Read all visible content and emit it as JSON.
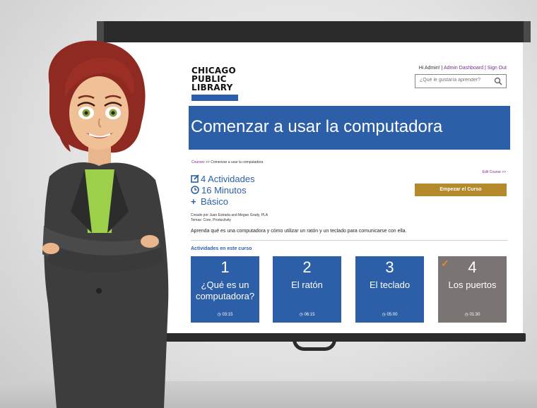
{
  "site": {
    "logo_lines": [
      "CHICAGO",
      "PUBLIC",
      "LIBRARY"
    ],
    "greeting": "Hi Admin! |",
    "nav_admin": "Admin Dashboard",
    "nav_sep": "|",
    "nav_signout": "Sign Out",
    "search_placeholder": "¿Qué le gustaría aprender?",
    "search_icon": "search-icon"
  },
  "course": {
    "title": "Comenzar a usar la computadora",
    "breadcrumb_link": "Courses",
    "breadcrumb_rest": " >> Comenzar a usar la computadora",
    "edit_label": "Edit Course >>",
    "activities": "4 Actividades",
    "minutes": "16 Minutos",
    "level": "Básico",
    "creator": "Creado por Juan Estrada and Megan Grady, PLA",
    "topics": "Temas: Core, Productivity",
    "description": "Aprenda qué es una computadora y cómo utilizar un ratón y un teclado para comunicarse con ella.",
    "start_button": "Empezar el Curso",
    "activities_heading": "Actividades en este curso"
  },
  "lessons": [
    {
      "number": "1",
      "title_line1": "¿Qué es un",
      "title_line2": "computadora?",
      "duration": "03:15",
      "completed": false
    },
    {
      "number": "2",
      "title_line1": "El ratón",
      "title_line2": "",
      "duration": "06:15",
      "completed": false
    },
    {
      "number": "3",
      "title_line1": "El teclado",
      "title_line2": "",
      "duration": "05:00",
      "completed": false
    },
    {
      "number": "4",
      "title_line1": "Los puertos",
      "title_line2": "",
      "duration": "01:30",
      "completed": true
    }
  ],
  "colors": {
    "brand_blue": "#2c5fa8",
    "start_button": "#b48a2a",
    "completed_card": "#7a7572",
    "link_purple": "#7a2a8c",
    "check_orange": "#e28a2a"
  }
}
